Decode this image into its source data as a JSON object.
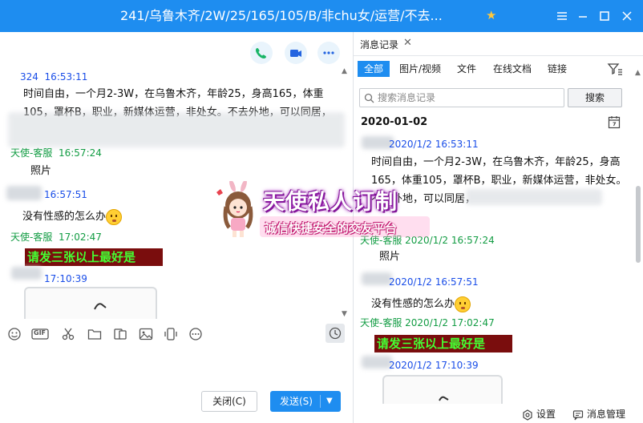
{
  "window": {
    "title": "241/乌鲁木齐/2W/25/165/105/B/非chu女/运营/不去..."
  },
  "chat": {
    "messages": [
      {
        "sender": "324",
        "time": "16:53:11",
        "text_line1": "时间自由，一个月2-3W，在乌鲁木齐，年龄25，身高165，体重",
        "text_line2": "105，罩杯B，职业，新媒体运营，非处女。不去外地，可以同居，"
      },
      {
        "sender": "天使-客服",
        "time": "16:57:24",
        "text": "照片"
      },
      {
        "sender": "",
        "time": "16:57:51",
        "text": "没有性感的怎么办"
      },
      {
        "sender": "天使-客服",
        "time": "17:02:47",
        "text": "请发三张以上最好是"
      },
      {
        "sender": "",
        "time": "17:10:39"
      }
    ]
  },
  "toolbar": {
    "icons": [
      "emoji-icon",
      "gif-icon",
      "scissors-icon",
      "folder-icon",
      "sticker-icon",
      "image-icon",
      "shake-icon",
      "more-icon"
    ],
    "gif_label": "GIF"
  },
  "actions": {
    "close_label": "关闭(C)",
    "send_label": "发送(S)"
  },
  "history": {
    "tab_title": "消息记录",
    "filters": [
      "全部",
      "图片/视频",
      "文件",
      "在线文档",
      "链接"
    ],
    "search_placeholder": "搜索消息记录",
    "search_button": "搜索",
    "date": "2020-01-02",
    "entries": [
      {
        "meta": "2020/1/2 16:53:11",
        "text_line1": "时间自由，一个月2-3W，在乌鲁木齐，年龄25，身高",
        "text_line2": "165，体重105，罩杯B，职业，新媒体运营，非处女。",
        "text_line3": "不去外地，可以同居，"
      },
      {
        "meta": "天使-客服 2020/1/2 16:57:24",
        "text": "照片"
      },
      {
        "meta": "2020/1/2 16:57:51",
        "text": "没有性感的怎么办"
      },
      {
        "meta": "天使-客服 2020/1/2 17:02:47",
        "text": "请发三张以上最好是"
      },
      {
        "meta": "2020/1/2 17:10:39"
      }
    ],
    "settings_label": "设置",
    "manage_label": "消息管理"
  },
  "watermark": {
    "title": "天使私人订制",
    "subtitle": "诚信快捷安全的交友平台"
  },
  "colors": {
    "titlebar": "#1e8df0",
    "sender_blue": "#1a4ee8",
    "sender_green": "#129c43",
    "banner_bg": "#7a0d0d",
    "banner_text": "#44ff33"
  }
}
